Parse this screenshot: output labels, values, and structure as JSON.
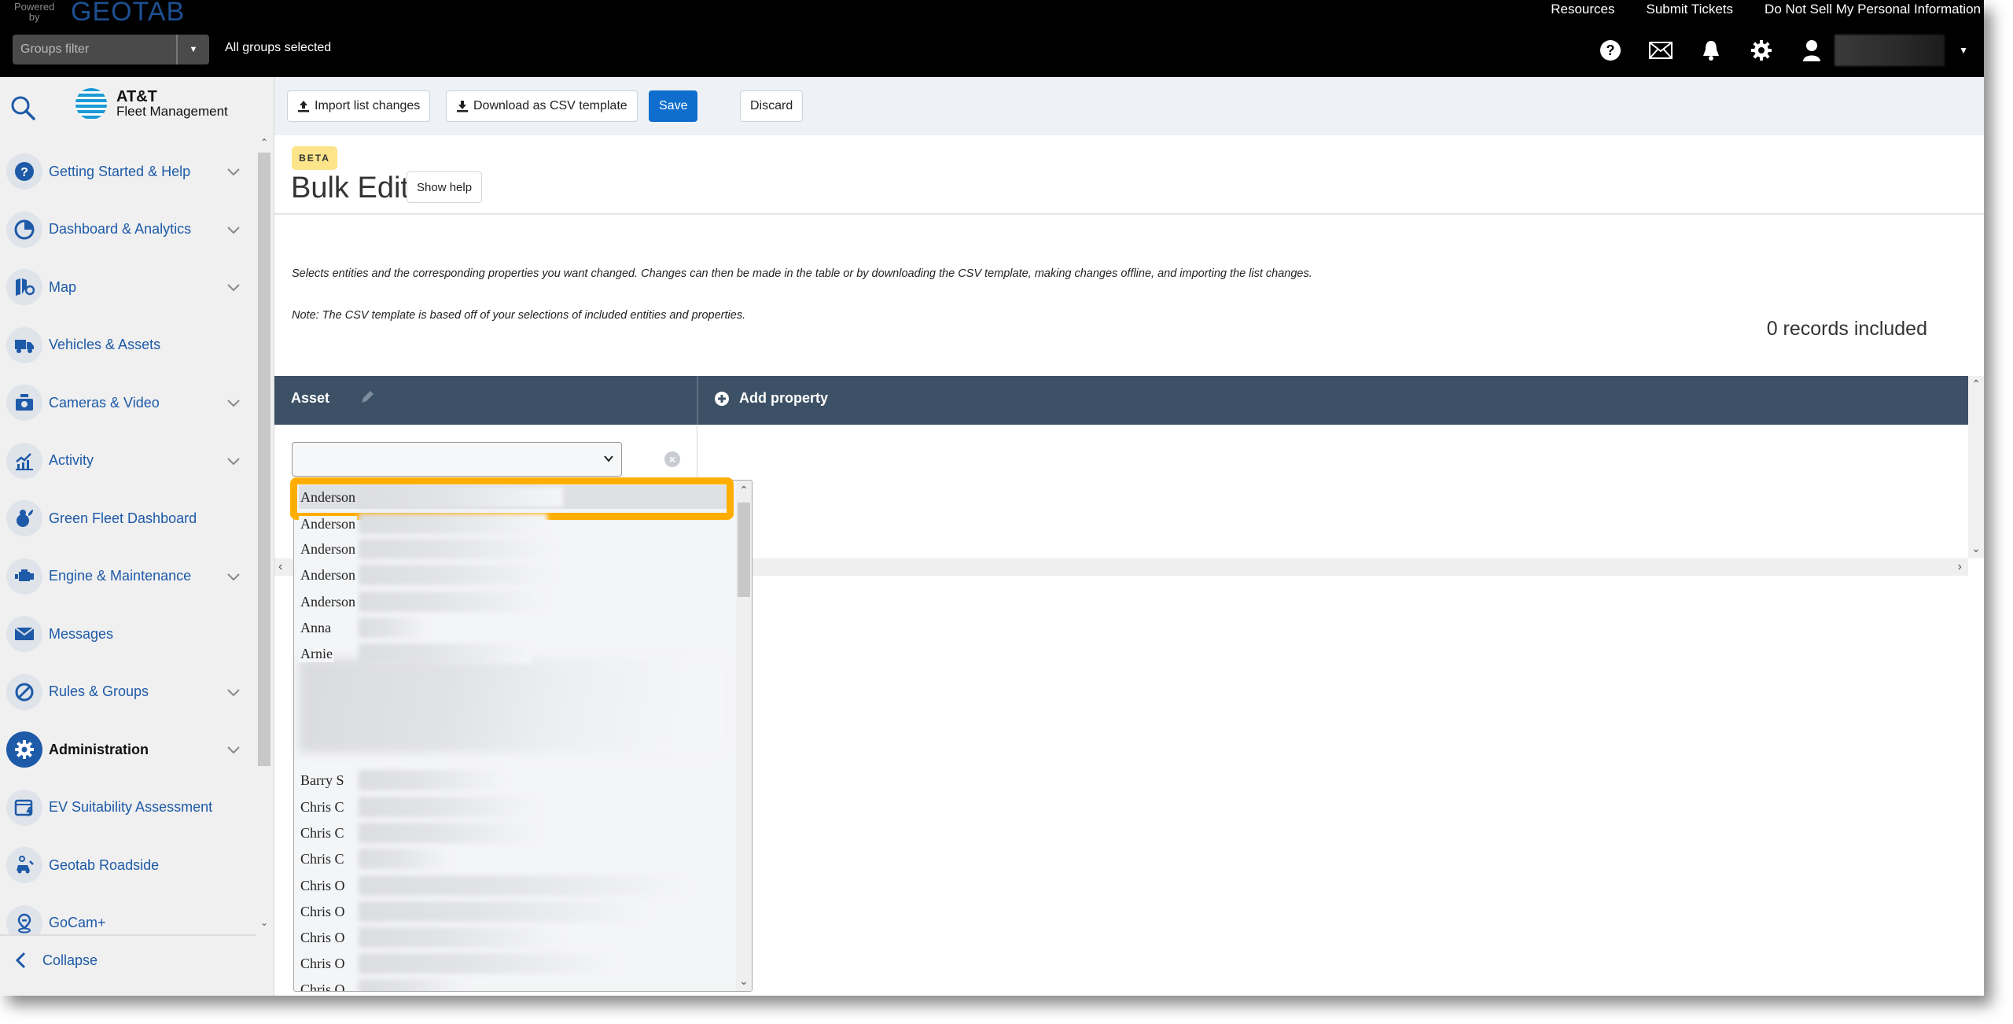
{
  "topbar": {
    "powered_by": "Powered by",
    "brand": "GEOTAB",
    "groups_filter_placeholder": "Groups filter",
    "groups_status": "All groups selected",
    "links": [
      "Resources",
      "Submit Tickets",
      "Do Not Sell My Personal Information"
    ],
    "icons": [
      "help-icon",
      "mail-icon",
      "bell-icon",
      "gear-icon",
      "user-icon"
    ]
  },
  "sidebar": {
    "brand_line1": "AT&T",
    "brand_line2": "Fleet Management",
    "items": [
      {
        "label": "Getting Started & Help",
        "icon": "help-circle-icon",
        "expandable": true
      },
      {
        "label": "Dashboard & Analytics",
        "icon": "pie-chart-icon",
        "expandable": true
      },
      {
        "label": "Map",
        "icon": "map-icon",
        "expandable": true
      },
      {
        "label": "Vehicles & Assets",
        "icon": "truck-icon",
        "expandable": false
      },
      {
        "label": "Cameras & Video",
        "icon": "camera-icon",
        "expandable": true
      },
      {
        "label": "Activity",
        "icon": "activity-chart-icon",
        "expandable": true
      },
      {
        "label": "Green Fleet Dashboard",
        "icon": "leaf-icon",
        "expandable": false
      },
      {
        "label": "Engine & Maintenance",
        "icon": "engine-icon",
        "expandable": true
      },
      {
        "label": "Messages",
        "icon": "envelope-icon",
        "expandable": false
      },
      {
        "label": "Rules & Groups",
        "icon": "rules-icon",
        "expandable": true
      },
      {
        "label": "Administration",
        "icon": "gear-icon",
        "expandable": true,
        "active": true
      },
      {
        "label": "EV Suitability Assessment",
        "icon": "ev-assessment-icon",
        "expandable": false
      },
      {
        "label": "Geotab Roadside",
        "icon": "roadside-icon",
        "expandable": false
      },
      {
        "label": "GoCam+",
        "icon": "gocam-icon",
        "expandable": false
      }
    ],
    "collapse_label": "Collapse"
  },
  "toolbar": {
    "import_label": "Import list changes",
    "download_label": "Download as CSV template",
    "save_label": "Save",
    "discard_label": "Discard"
  },
  "page": {
    "badge": "BETA",
    "title": "Bulk Edit",
    "show_help_label": "Show help",
    "description": "Selects entities and the corresponding properties you want changed. Changes can then be made in the table or by downloading the CSV template, making changes offline, and importing the list changes.",
    "note": "Note: The CSV template is based off of your selections of included entities and properties.",
    "records_included": "0 records included"
  },
  "table": {
    "entity_column": "Asset",
    "add_property_label": "Add property",
    "asset_select_value": ""
  },
  "dropdown": {
    "options": [
      {
        "label": "Anderson",
        "selected": true
      },
      {
        "label": "Anderson"
      },
      {
        "label": "Anderson"
      },
      {
        "label": "Anderson"
      },
      {
        "label": "Anderson"
      },
      {
        "label": "Anna"
      },
      {
        "label": "Arnie"
      },
      {
        "label": "Barry S"
      },
      {
        "label": "Chris C"
      },
      {
        "label": "Chris C"
      },
      {
        "label": "Chris C"
      },
      {
        "label": "Chris O"
      },
      {
        "label": "Chris O"
      },
      {
        "label": "Chris O"
      },
      {
        "label": "Chris O"
      },
      {
        "label": "Chris O"
      }
    ]
  },
  "colors": {
    "topbar_bg": "#000000",
    "brand_blue": "#1d5aa8",
    "table_header": "#3d5166",
    "primary_button": "#0f6ecd",
    "highlight": "#ffae00",
    "beta_badge": "#fbe48a"
  }
}
